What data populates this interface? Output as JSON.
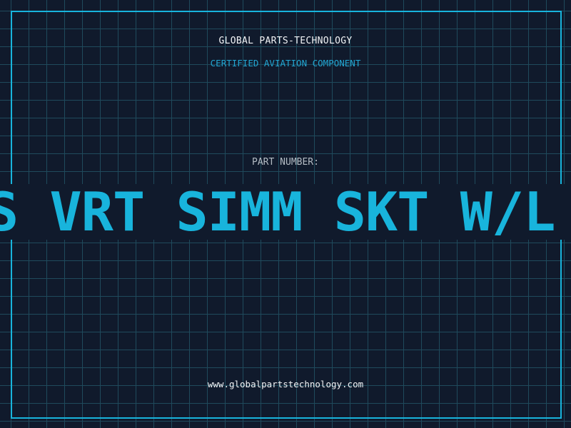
{
  "header": {
    "brand": "GLOBAL PARTS-TECHNOLOGY",
    "subtitle": "CERTIFIED AVIATION COMPONENT"
  },
  "part": {
    "label": "PART NUMBER:",
    "number": "S VRT SIMM SKT W/L"
  },
  "footer": {
    "website": "www.globalpartstechnology.com"
  },
  "colors": {
    "background": "#101a2c",
    "grid": "#1f4a5c",
    "accent": "#18b4dc",
    "text": "#f2f4f6",
    "muted_text": "#b4bcc4"
  }
}
